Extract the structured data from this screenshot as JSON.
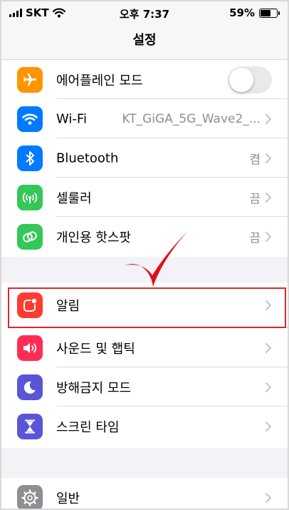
{
  "status_bar": {
    "carrier": "SKT",
    "time": "오후 7:37",
    "battery": "59%"
  },
  "nav": {
    "title": "설정"
  },
  "group1": [
    {
      "label": "에어플레인 모드",
      "icon": "airplane-icon",
      "color": "#ff9500",
      "value": ""
    },
    {
      "label": "Wi-Fi",
      "icon": "wifi-icon",
      "color": "#007aff",
      "value": "KT_GiGA_5G_Wave2_..."
    },
    {
      "label": "Bluetooth",
      "icon": "bluetooth-icon",
      "color": "#007aff",
      "value": "켬"
    },
    {
      "label": "셀룰러",
      "icon": "cellular-icon",
      "color": "#34c759",
      "value": "끔"
    },
    {
      "label": "개인용 핫스팟",
      "icon": "hotspot-icon",
      "color": "#34c759",
      "value": "끔"
    }
  ],
  "group2": [
    {
      "label": "알림",
      "icon": "notifications-icon",
      "color": "#ff3b30"
    },
    {
      "label": "사운드 및 햅틱",
      "icon": "sound-icon",
      "color": "#ff2d55"
    },
    {
      "label": "방해금지 모드",
      "icon": "moon-icon",
      "color": "#5856d6"
    },
    {
      "label": "스크린 타임",
      "icon": "hourglass-icon",
      "color": "#5856d6"
    }
  ],
  "group3": [
    {
      "label": "일반",
      "icon": "gear-icon",
      "color": "#8e8e93"
    }
  ],
  "annotation": {
    "highlight_color": "#e0262b",
    "check_color": "#e0101a"
  }
}
